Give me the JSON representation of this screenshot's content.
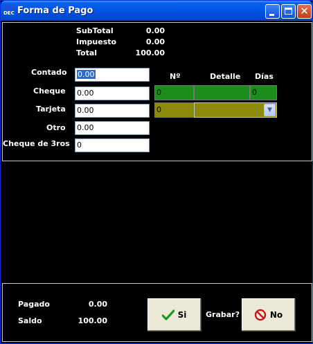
{
  "window": {
    "title": "Forma de Pago",
    "icon": "app-dec-icon",
    "icon_text": "DEC",
    "controls": {
      "minimize": "minimize-icon",
      "maximize": "maximize-icon",
      "close": "close-icon"
    }
  },
  "totals": {
    "subtotal_label": "SubTotal",
    "subtotal_value": "0.00",
    "impuesto_label": "Impuesto",
    "impuesto_value": "0.00",
    "total_label": "Total",
    "total_value": "100.00"
  },
  "payment_methods": {
    "contado": {
      "label": "Contado",
      "value": "0.00"
    },
    "cheque": {
      "label": "Cheque",
      "value": "0.00"
    },
    "tarjeta": {
      "label": "Tarjeta",
      "value": "0.00"
    },
    "otro": {
      "label": "Otro",
      "value": "0.00"
    },
    "cheque3": {
      "label": "Cheque de 3ros",
      "value": "0"
    }
  },
  "details_table": {
    "headers": {
      "numero": "Nº",
      "detalle": "Detalle",
      "dias": "Días"
    },
    "cheque_row": {
      "numero": "0",
      "detalle": "",
      "dias": "0"
    },
    "tarjeta_row": {
      "numero": "0",
      "detalle": ""
    }
  },
  "footer": {
    "pagado_label": "Pagado",
    "pagado_value": "0.00",
    "saldo_label": "Saldo",
    "saldo_value": "100.00",
    "grabar_label": "Grabar?",
    "si_label": "Si",
    "no_label": "No"
  },
  "colors": {
    "background": "#000000",
    "cheque_row": "#1c8c1c",
    "tarjeta_row": "#8c8a0a",
    "titlebar": "#0054e3"
  }
}
